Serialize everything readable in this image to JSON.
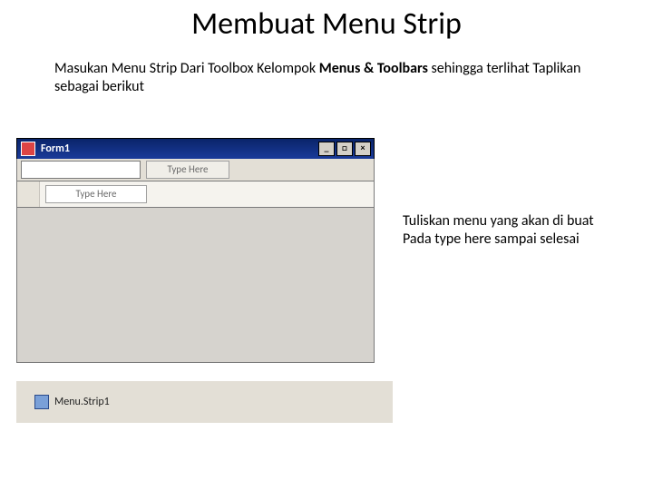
{
  "title": "Membuat Menu Strip",
  "instructions": {
    "pre": "Masukan Menu Strip Dari Toolbox Kelompok ",
    "bold": "Menus & Toolbars",
    "post": " sehingga terlihat Taplikan sebagai berikut"
  },
  "window": {
    "title": "Form1",
    "min": "_",
    "max": "□",
    "close": "×",
    "typeHereTop": "Type Here",
    "typeHereSub": "Type Here"
  },
  "tray": {
    "label": "Menu.Strip1"
  },
  "sidenote": {
    "line1": "Tuliskan menu yang akan di buat",
    "line2": "Pada type here sampai selesai"
  }
}
